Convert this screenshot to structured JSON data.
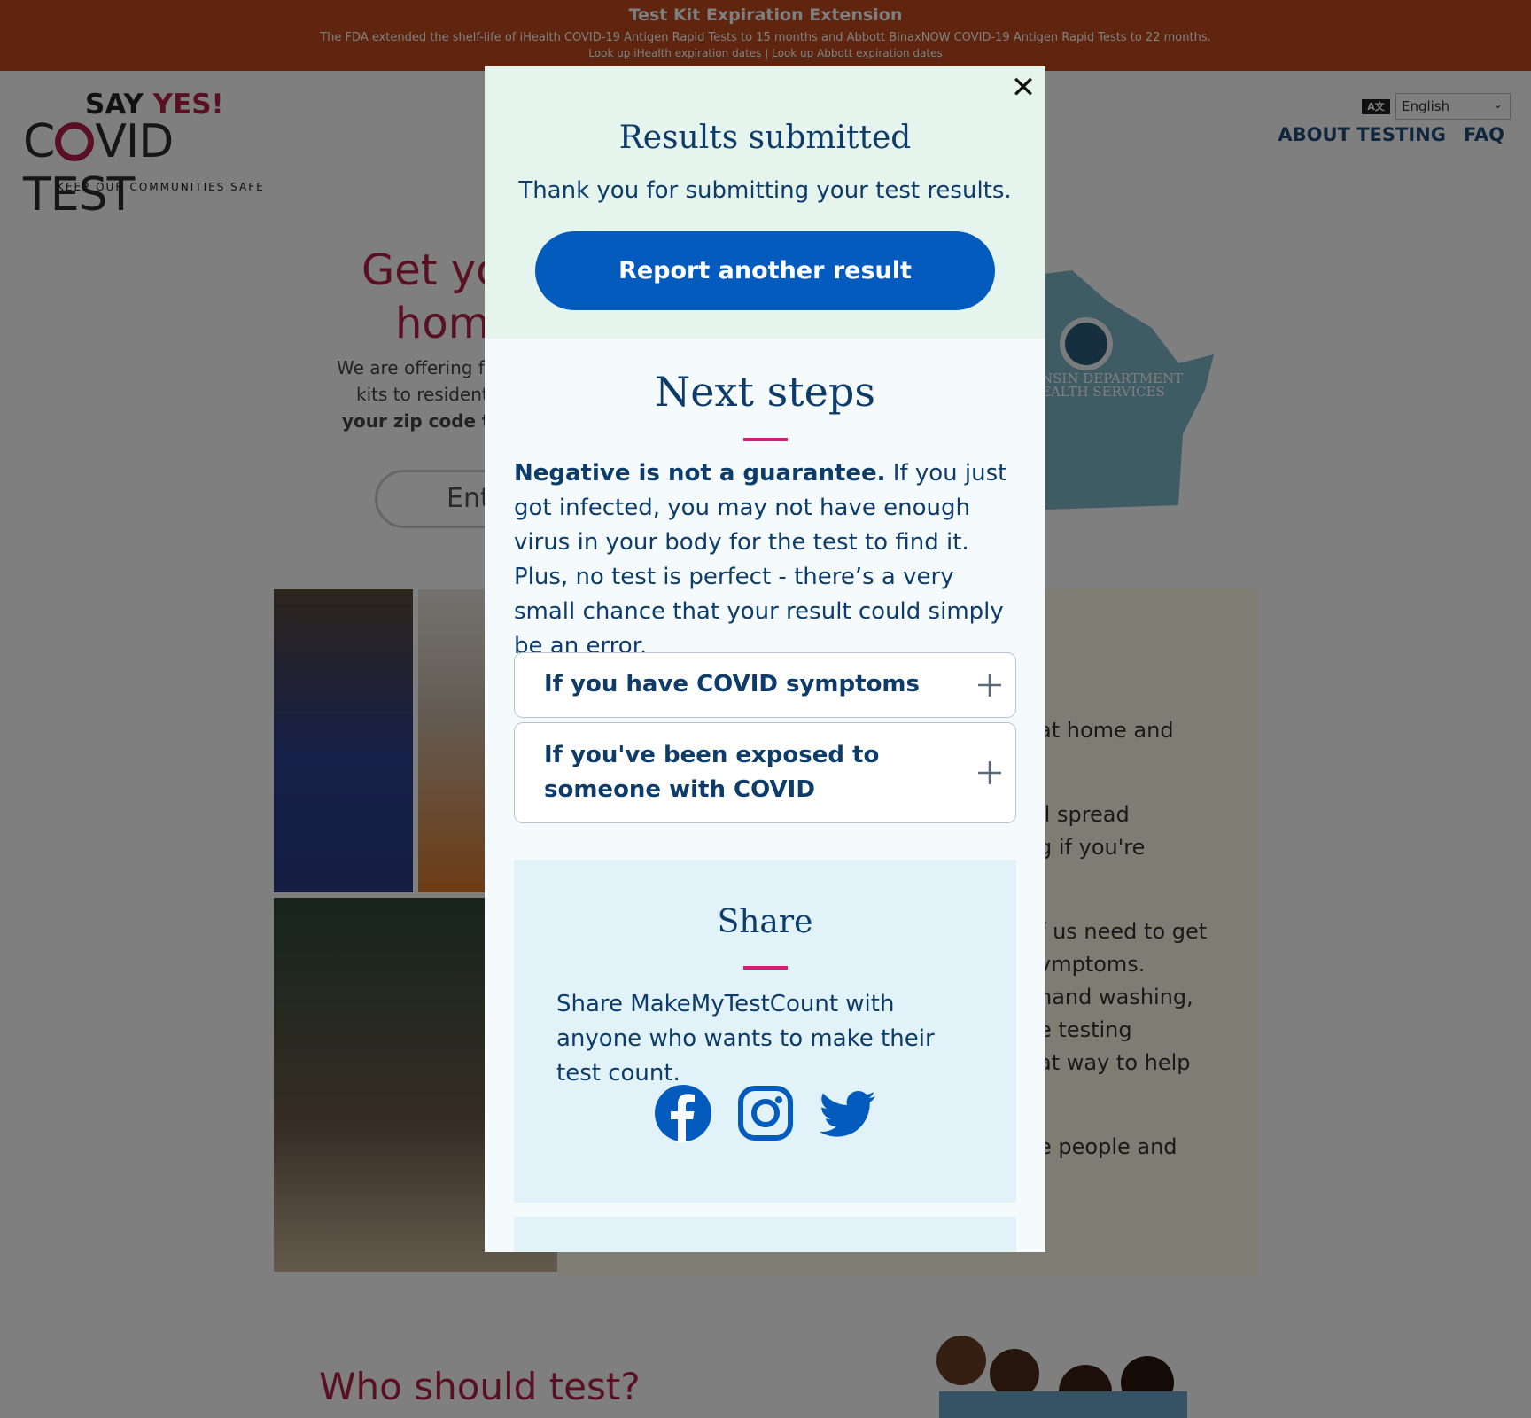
{
  "banner": {
    "title": "Test Kit Expiration Extension",
    "description": "The FDA extended the shelf-life of iHealth COVID-19 Antigen Rapid Tests to 15 months and Abbott BinaxNOW COVID-19 Antigen Rapid Tests to 22 months.",
    "link_ihealth": "Look up iHealth expiration dates",
    "separator": "|",
    "link_abbott": "Look up Abbott expiration dates",
    "color": "#c04a1c"
  },
  "header": {
    "logo_say": "SAY ",
    "logo_yes": "YES!",
    "logo_c": "C",
    "logo_vid": "VID TEST",
    "logo_tagline": "KEEP OUR COMMUNITIES SAFE",
    "language_icon": "translate-icon",
    "language_selected": "English",
    "nav": [
      "ABOUT TESTING",
      "FAQ"
    ]
  },
  "background": {
    "hero_title_line1": "Get yo",
    "hero_title_line2": "hom",
    "hero_text_line1": "We are offering fre",
    "hero_text_line2": "kits to residents",
    "hero_text_line3": "your zip code to s",
    "zip_placeholder": "Ent",
    "dept_line1": "NSIN DEPARTMENT",
    "dept_line2": "EALTH SERVICES",
    "right_fragments": [
      "at home and",
      "ll spread",
      "g if you're",
      "f us need to get",
      "ymptoms.",
      "hand washing,",
      "e testing",
      "at way to help",
      "e people and"
    ],
    "who_title": "Who should test?"
  },
  "modal": {
    "close_icon": "close-icon",
    "title": "Results submitted",
    "subtitle": "Thank you for submitting your test results.",
    "report_button": "Report another result",
    "next_steps_title": "Next steps",
    "negative_bold": "Negative is not a guarantee.",
    "negative_text": " If you just got infected, you may not have enough virus in your body for the test to find it. Plus, no test is perfect - there’s a very small chance that your result could simply be an error.",
    "accordions": [
      {
        "label": "If you have COVID symptoms",
        "icon": "plus-icon"
      },
      {
        "label": "If you've been exposed to someone with COVID",
        "icon": "plus-icon"
      }
    ],
    "share_title": "Share",
    "share_text": "Share MakeMyTestCount with anyone who wants to make their test count.",
    "social_icons": [
      "facebook-icon",
      "instagram-icon",
      "twitter-icon"
    ],
    "accent_color": "#035bbd",
    "rule_color": "#d81b73",
    "text_color": "#0d3c6b"
  }
}
